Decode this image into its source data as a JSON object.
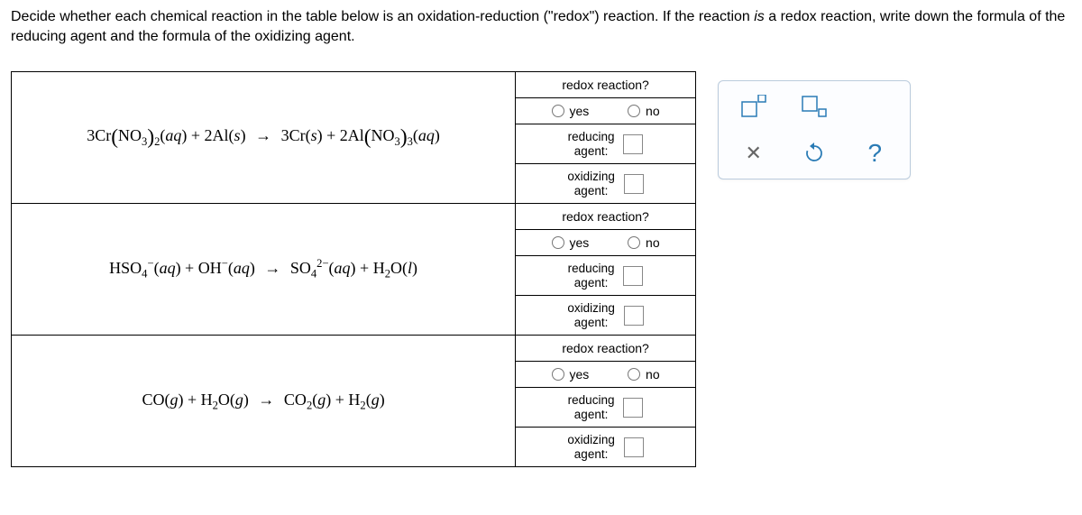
{
  "instructions": {
    "part1": "Decide whether each chemical reaction in the table below is an oxidation-reduction (\"redox\") reaction. If the reaction ",
    "emph": "is",
    "part2": " a redox reaction, write down the formula of the reducing agent and the formula of the oxidizing agent."
  },
  "labels": {
    "redox_q": "redox reaction?",
    "yes": "yes",
    "no": "no",
    "reducing": "reducing agent:",
    "oxidizing": "oxidizing agent:"
  },
  "reactions": [
    {
      "id": "r1",
      "html": "3Cr<span class='paren'>(</span>NO<sub>3</sub><span class='paren'>)</span><sub>2</sub>(<i>aq</i>) + 2Al(<i>s</i>) <span class='arrow'>→</span> 3Cr(<i>s</i>) + 2Al<span class='paren'>(</span>NO<sub>3</sub><span class='paren'>)</span><sub>3</sub>(<i>aq</i>)"
    },
    {
      "id": "r2",
      "html": "HSO<sub>4</sub><sup>−</sup>(<i>aq</i>) + OH<sup>−</sup>(<i>aq</i>) <span class='arrow'>→</span> SO<sub>4</sub><sup>2−</sup>(<i>aq</i>) + H<sub>2</sub>O(<i>l</i>)"
    },
    {
      "id": "r3",
      "html": "CO(<i>g</i>) + H<sub>2</sub>O(<i>g</i>) <span class='arrow'>→</span> CO<sub>2</sub>(<i>g</i>) + H<sub>2</sub>(<i>g</i>)"
    }
  ],
  "toolbox": {
    "superscript": "superscript-tool",
    "subscript": "subscript-tool",
    "clear": "clear-tool",
    "reset": "reset-tool",
    "help": "help-tool"
  }
}
